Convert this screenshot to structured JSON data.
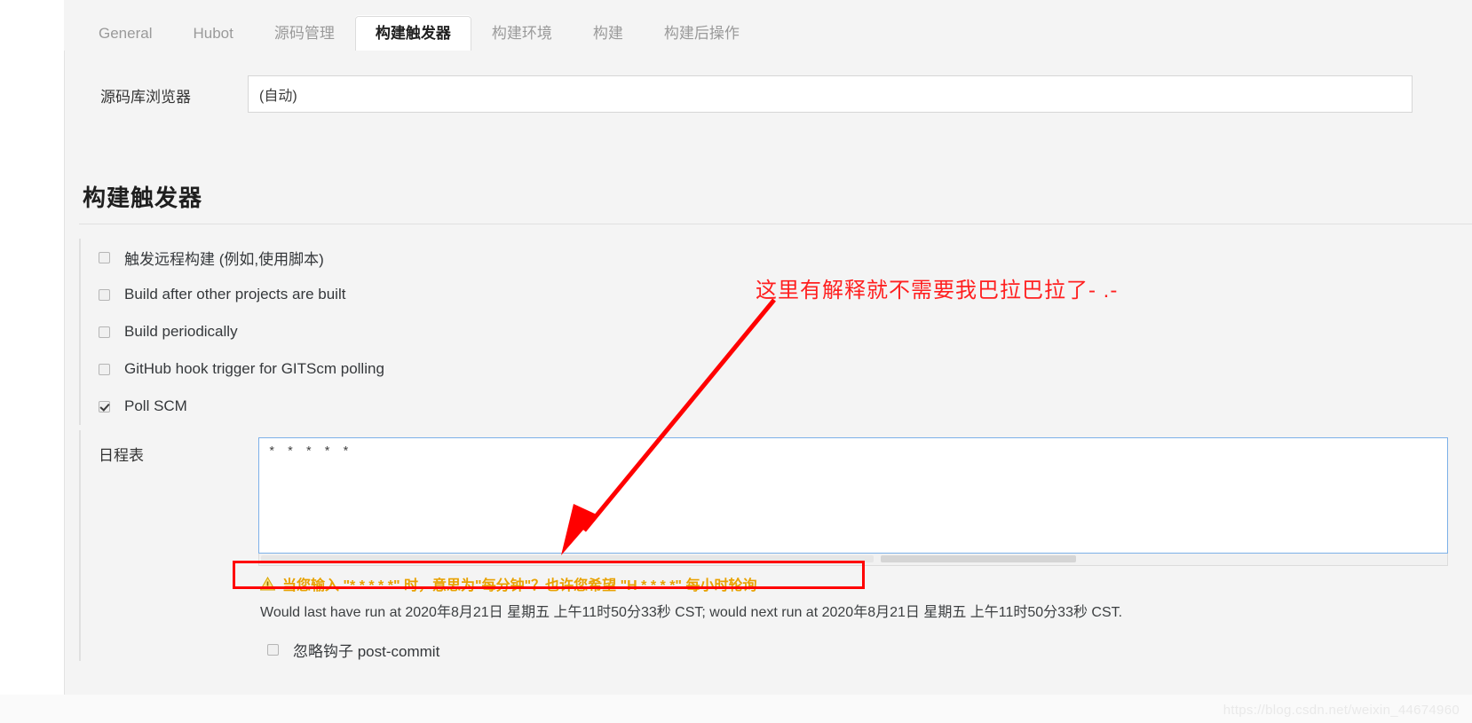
{
  "tabs": [
    {
      "label": "General",
      "active": false
    },
    {
      "label": "Hubot",
      "active": false
    },
    {
      "label": "源码管理",
      "active": false
    },
    {
      "label": "构建触发器",
      "active": true
    },
    {
      "label": "构建环境",
      "active": false
    },
    {
      "label": "构建",
      "active": false
    },
    {
      "label": "构建后操作",
      "active": false
    }
  ],
  "scm": {
    "label": "源码库浏览器",
    "selected": "(自动)"
  },
  "section": {
    "title": "构建触发器"
  },
  "triggers": [
    {
      "label": "触发远程构建 (例如,使用脚本)",
      "checked": false
    },
    {
      "label": "Build after other projects are built",
      "checked": false
    },
    {
      "label": "Build periodically",
      "checked": false
    },
    {
      "label": "GitHub hook trigger for GITScm polling",
      "checked": false
    },
    {
      "label": "Poll SCM",
      "checked": true
    }
  ],
  "schedule": {
    "label": "日程表",
    "value": "* * * * *",
    "warning": "当您输入 \"* * * * *\" 时，意思为\"每分钟\"？也许您希望 \"H * * * *\" 每小时轮询",
    "next_run": "Would last have run at 2020年8月21日 星期五 上午11时50分33秒 CST; would next run at 2020年8月21日 星期五 上午11时50分33秒 CST.",
    "ignore_hook_label": "忽略钩子 post-commit",
    "ignore_hook_checked": false
  },
  "annotation": {
    "text": "这里有解释就不需要我巴拉巴拉了- .-",
    "color": "#ff1f1f"
  },
  "watermark": "https://blog.csdn.net/weixin_44674960",
  "colors": {
    "page_bg": "#f4f4f4",
    "warning": "#e8a202",
    "annotation": "#ff0000",
    "focus_border": "#7cb0e8"
  }
}
